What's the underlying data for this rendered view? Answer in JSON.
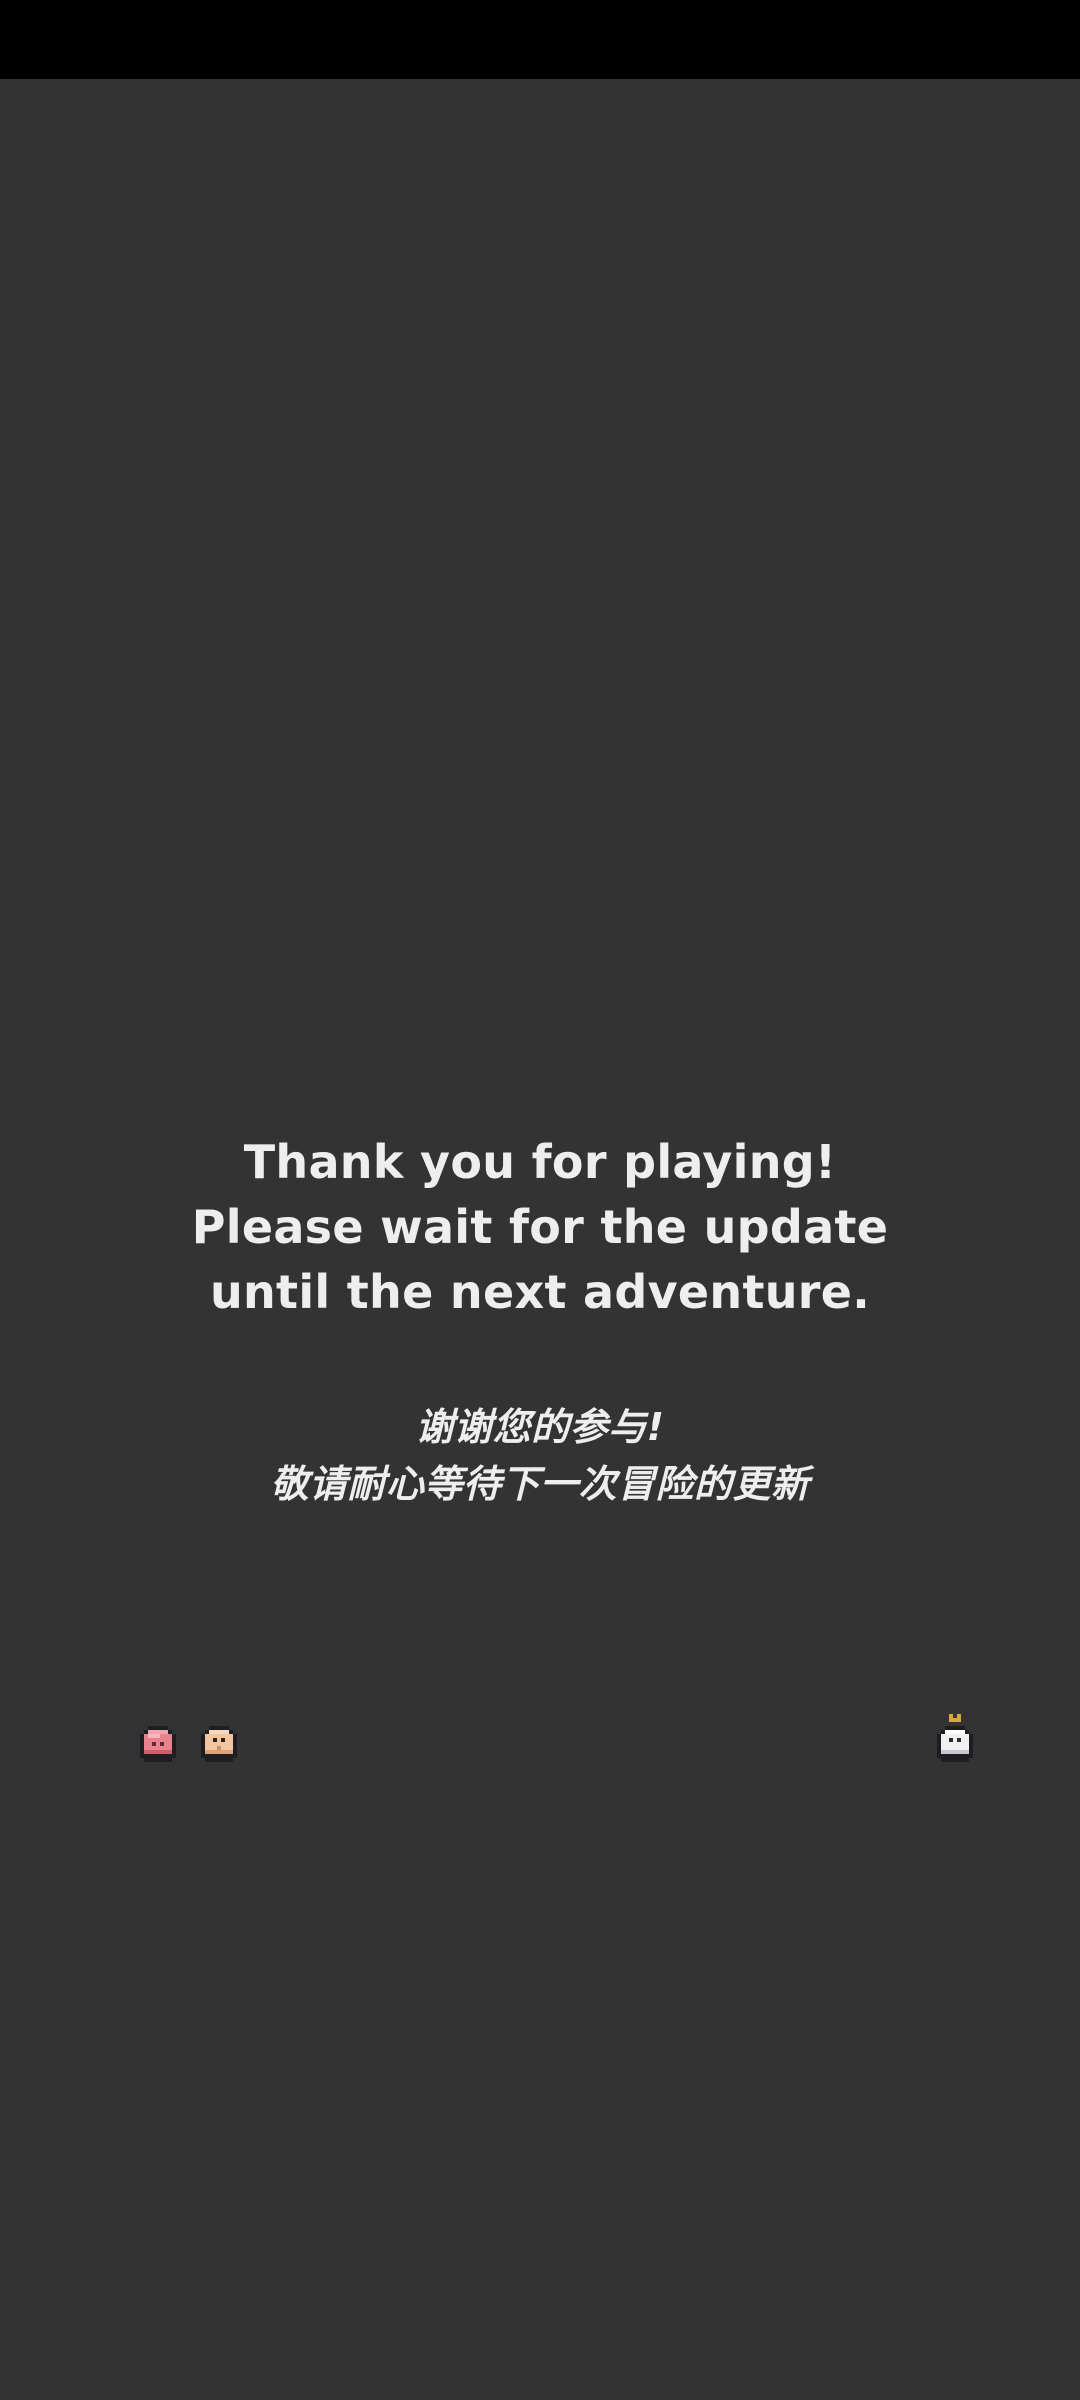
{
  "screen": {
    "background": "#333333",
    "status_bar_color": "#000000"
  },
  "message": {
    "english_lines": [
      "Thank you for playing!",
      "Please wait for the update",
      "until the next adventure."
    ],
    "chinese_lines": [
      "谢谢您的参与!",
      "敬请耐心等待下一次冒险的更新"
    ],
    "text_color": "#eeeeee"
  },
  "sprites": {
    "left": [
      {
        "name": "pink-slime-sprite",
        "color": "#e8828c"
      },
      {
        "name": "peach-character-sprite",
        "color": "#f2c6a0"
      }
    ],
    "right": [
      {
        "name": "white-ghost-sprite",
        "color": "#f0f0f0",
        "accent": "#d4a93a"
      }
    ]
  }
}
